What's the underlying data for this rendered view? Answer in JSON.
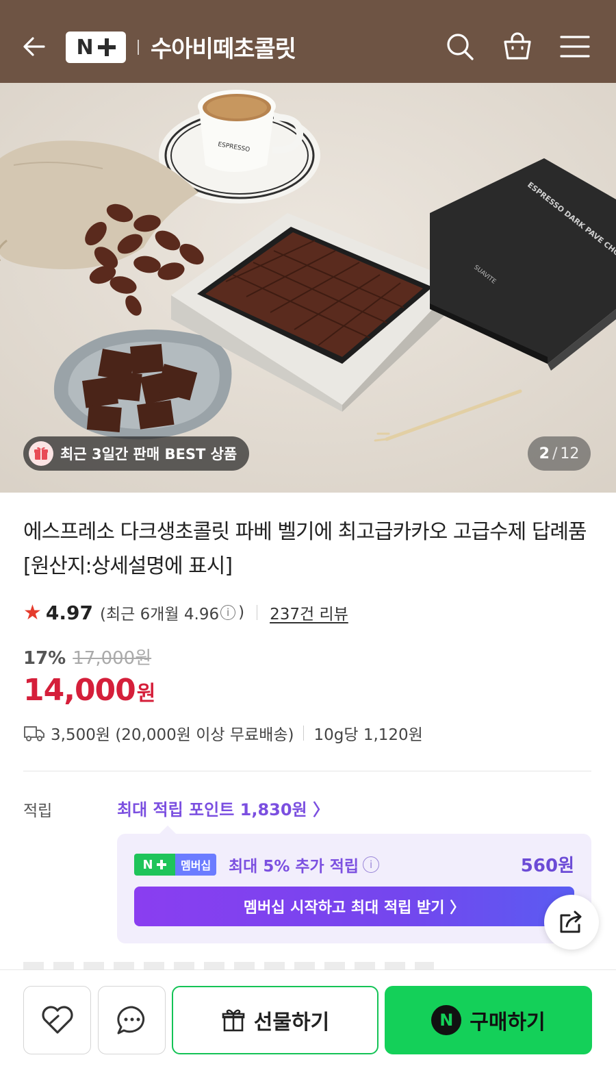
{
  "header": {
    "brand_badge_n": "N",
    "store_name": "수아비떼초콜릿",
    "bg_color": "#6e5444"
  },
  "hero": {
    "badge_text": "최근 3일간 판매 BEST 상품",
    "page_current": "2",
    "page_separator": "/",
    "page_total": "12",
    "box_text_1": "ESPRESSO DARK PAVE CHOC",
    "box_text_2": "SUAVITE",
    "cup_text": "ESPRESSO"
  },
  "product": {
    "title": "에스프레소 다크생초콜릿 파베 벨기에 최고급카카오 고급수제 답례품 [원산지:상세설명에 표시]",
    "rating_star": "★",
    "rating": "4.97",
    "recent_rating_prefix": "(최근 6개월 4.96",
    "recent_rating_info": "i",
    "recent_rating_suffix": ")",
    "review_count": "237건 리뷰",
    "discount_pct": "17%",
    "original_price": "17,000원",
    "price": "14,000",
    "price_unit": "원",
    "shipping": "3,500원 (20,000원 이상 무료배송)",
    "unit_price": "10g당 1,120원"
  },
  "points": {
    "label": "적립",
    "max_points_link": "최대 적립 포인트 1,830원 〉",
    "member_badge_n": "N",
    "member_badge_label": "멤버십",
    "extra_text": "최대 5% 추가 적립",
    "extra_info": "i",
    "extra_amount": "560원",
    "cta": "멤버십 시작하고 최대 적립 받기 〉"
  },
  "bottom_bar": {
    "gift_label": "선물하기",
    "buy_n": "N",
    "buy_label": "구매하기"
  },
  "colors": {
    "accent_red": "#d51f3a",
    "accent_purple": "#7b4fe0",
    "naver_green": "#14d059",
    "star": "#e53b2c"
  },
  "icons": {
    "back": "arrow-left-icon",
    "search": "search-icon",
    "cart": "shopping-bag-icon",
    "menu": "hamburger-menu-icon",
    "gift_badge": "gift-icon",
    "share": "share-icon",
    "like": "heart-icon",
    "chat": "chat-bubble-icon",
    "gift_button": "gift-box-icon",
    "delivery": "truck-icon"
  }
}
